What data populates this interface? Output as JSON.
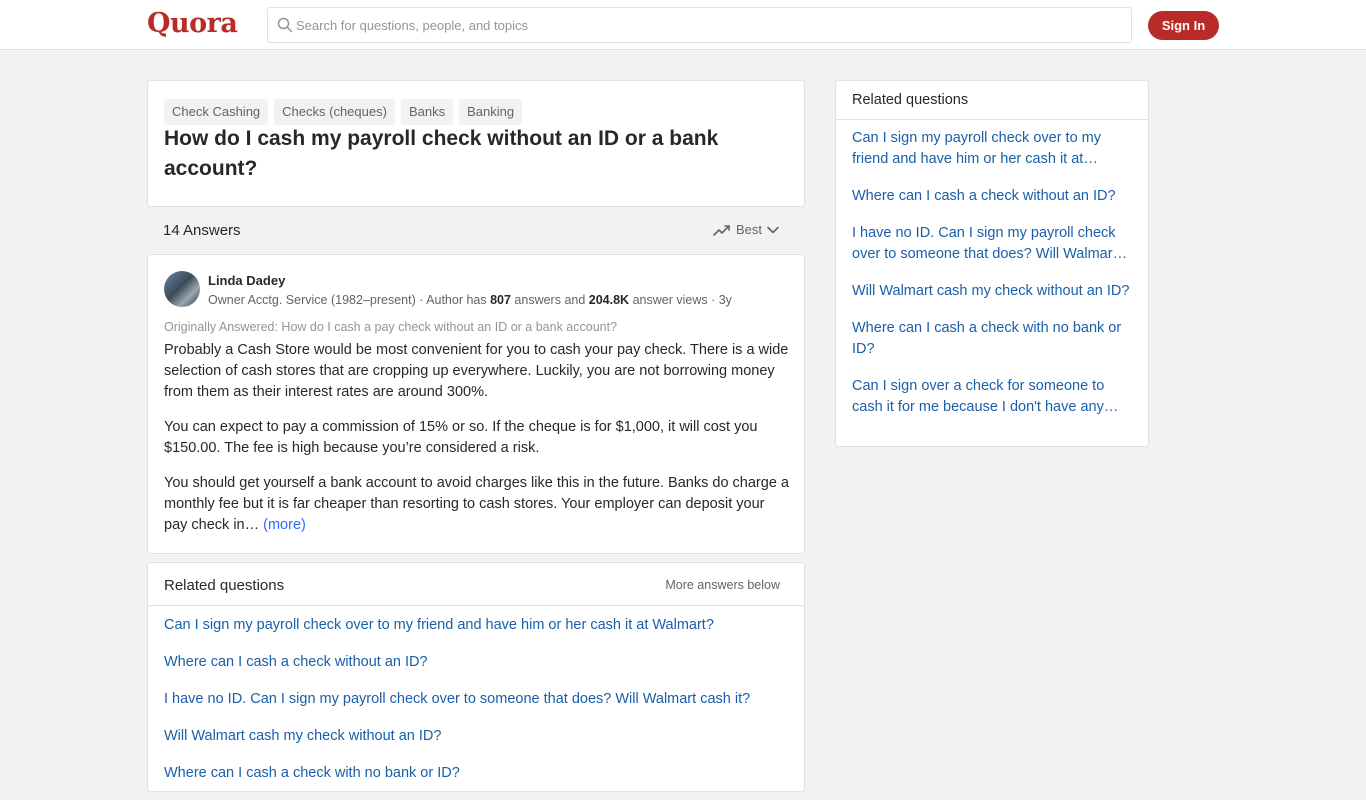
{
  "header": {
    "logo": "Quora",
    "search_placeholder": "Search for questions, people, and topics",
    "signin_label": "Sign In"
  },
  "question": {
    "topics": [
      "Check Cashing",
      "Checks (cheques)",
      "Banks",
      "Banking"
    ],
    "title": "How do I cash my payroll check without an ID or a bank account?"
  },
  "answers_bar": {
    "count": "14 Answers",
    "sort_label": "Best"
  },
  "answer": {
    "author_name": "Linda Dadey",
    "cred_prefix": "Owner Acctg. Service (1982–present) · Author has ",
    "answers_count": "807",
    "cred_mid": " answers and ",
    "views_count": "204.8K",
    "cred_suffix": " answer views · 3y",
    "originally": "Originally Answered: How do I cash a pay check without an ID or a bank account?",
    "p1": "Probably a Cash Store would be most convenient for you to cash your pay check. There is a wide selection of cash stores that are cropping up everywhere. Luckily, you are not borrowing money from them as their interest rates are around 300%.",
    "p2": "You can expect to pay a commission of 15% or so. If the cheque is for $1,000, it will cost you $150.00. The fee is high because you’re considered a risk.",
    "p3": "You should get yourself a bank account to avoid charges like this in the future. Banks do charge a monthly fee but it is far cheaper than resorting to cash stores. Your employer can deposit your pay check in…",
    "more_label": "(more)"
  },
  "related_main": {
    "heading": "Related questions",
    "more_label": "More answers below",
    "items": [
      "Can I sign my payroll check over to my friend and have him or her cash it at Walmart?",
      "Where can I cash a check without an ID?",
      "I have no ID. Can I sign my payroll check over to someone that does? Will Walmart cash it?",
      "Will Walmart cash my check without an ID?",
      "Where can I cash a check with no bank or ID?"
    ]
  },
  "related_side": {
    "heading": "Related questions",
    "items": [
      "Can I sign my payroll check over to my friend and have him or her cash it at…",
      "Where can I cash a check without an ID?",
      "I have no ID. Can I sign my payroll check over to someone that does? Will Walmar…",
      "Will Walmart cash my check without an ID?",
      "Where can I cash a check with no bank or ID?",
      "Can I sign over a check for someone to cash it for me because I don't have any…"
    ]
  },
  "colors": {
    "brand": "#b92b27",
    "link": "#195faa",
    "page_bg": "#f1f2f2"
  }
}
